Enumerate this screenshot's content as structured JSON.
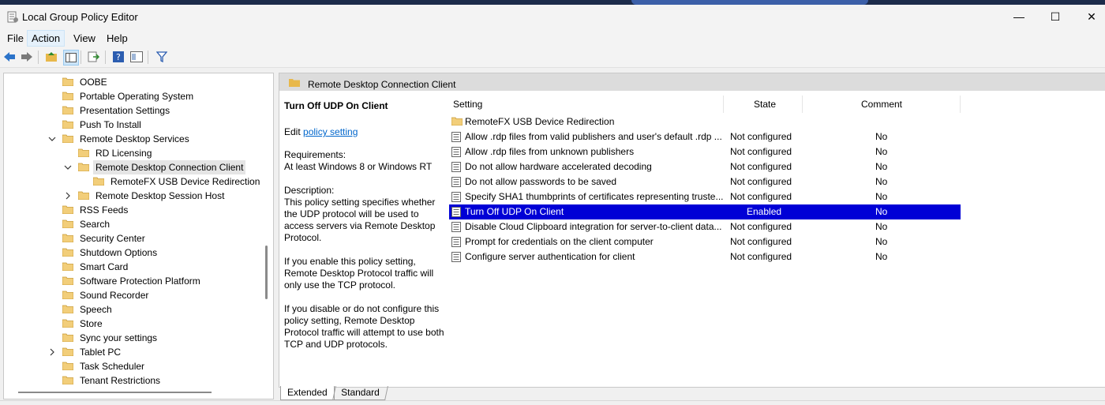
{
  "window": {
    "title": "Local Group Policy Editor",
    "minimize": "—",
    "maximize": "☐",
    "close": "✕"
  },
  "menu": {
    "file": "File",
    "action": "Action",
    "view": "View",
    "help": "Help"
  },
  "tree": {
    "items": [
      {
        "label": "OOBE"
      },
      {
        "label": "Portable Operating System"
      },
      {
        "label": "Presentation Settings"
      },
      {
        "label": "Push To Install"
      },
      {
        "label": "Remote Desktop Services"
      },
      {
        "label": "RD Licensing"
      },
      {
        "label": "Remote Desktop Connection Client"
      },
      {
        "label": "RemoteFX USB Device Redirection"
      },
      {
        "label": "Remote Desktop Session Host"
      },
      {
        "label": "RSS Feeds"
      },
      {
        "label": "Search"
      },
      {
        "label": "Security Center"
      },
      {
        "label": "Shutdown Options"
      },
      {
        "label": "Smart Card"
      },
      {
        "label": "Software Protection Platform"
      },
      {
        "label": "Sound Recorder"
      },
      {
        "label": "Speech"
      },
      {
        "label": "Store"
      },
      {
        "label": "Sync your settings"
      },
      {
        "label": "Tablet PC"
      },
      {
        "label": "Task Scheduler"
      },
      {
        "label": "Tenant Restrictions"
      }
    ]
  },
  "right": {
    "header_title": "Remote Desktop Connection Client",
    "description": {
      "title": "Turn Off UDP On Client",
      "edit_prefix": "Edit ",
      "edit_link": "policy setting ",
      "req_label": "Requirements:",
      "req_value": "At least Windows 8 or Windows RT",
      "desc_label": "Description:",
      "desc_p1": "This policy setting specifies whether the UDP protocol will be used to access servers via Remote Desktop Protocol.",
      "desc_p2": "If you enable this policy setting, Remote Desktop Protocol traffic will only use the TCP protocol.",
      "desc_p3": "If you disable or do not configure this policy setting, Remote Desktop Protocol traffic will attempt to use both TCP and UDP protocols."
    },
    "columns": {
      "setting": "Setting",
      "state": "State",
      "comment": "Comment"
    },
    "rows": [
      {
        "setting": "RemoteFX USB Device Redirection",
        "state": "",
        "comment": ""
      },
      {
        "setting": "Allow .rdp files from valid publishers and user's default .rdp ...",
        "state": "Not configured",
        "comment": "No"
      },
      {
        "setting": "Allow .rdp files from unknown publishers",
        "state": "Not configured",
        "comment": "No"
      },
      {
        "setting": "Do not allow hardware accelerated decoding",
        "state": "Not configured",
        "comment": "No"
      },
      {
        "setting": "Do not allow passwords to be saved",
        "state": "Not configured",
        "comment": "No"
      },
      {
        "setting": "Specify SHA1 thumbprints of certificates representing truste...",
        "state": "Not configured",
        "comment": "No"
      },
      {
        "setting": "Turn Off UDP On Client",
        "state": "Enabled",
        "comment": "No"
      },
      {
        "setting": "Disable Cloud Clipboard integration for server-to-client data...",
        "state": "Not configured",
        "comment": "No"
      },
      {
        "setting": "Prompt for credentials on the client computer",
        "state": "Not configured",
        "comment": "No"
      },
      {
        "setting": "Configure server authentication for client",
        "state": "Not configured",
        "comment": "No"
      }
    ]
  },
  "tabs": {
    "extended": "Extended",
    "standard": "Standard"
  },
  "colors": {
    "selection": "#0000d6",
    "folder": "#e8b84a",
    "link": "#0066cc"
  }
}
